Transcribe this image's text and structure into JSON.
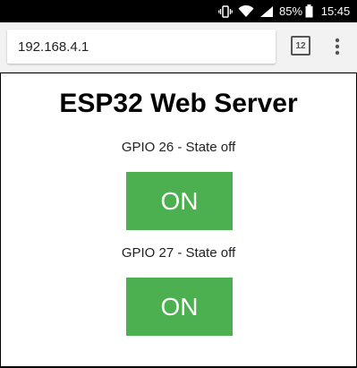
{
  "status_bar": {
    "battery_percent": "85%",
    "time": "15:45",
    "icons": [
      "vibrate-icon",
      "wifi-icon",
      "signal-icon",
      "battery-icon"
    ]
  },
  "browser": {
    "url": "192.168.4.1",
    "tab_count": "12",
    "menu_icon": "more-vert-icon"
  },
  "page": {
    "title": "ESP32 Web Server",
    "outputs": [
      {
        "label": "GPIO 26 - State off",
        "button_label": "ON"
      },
      {
        "label": "GPIO 27 - State off",
        "button_label": "ON"
      }
    ],
    "button_color": "#4caf50"
  }
}
